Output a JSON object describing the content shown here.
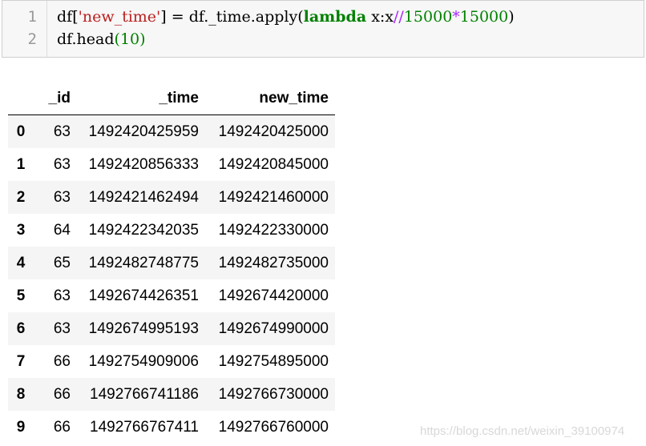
{
  "code_cell": {
    "line_numbers": [
      "1",
      "2"
    ],
    "line1": {
      "p1": "df[",
      "str": "'new_time'",
      "p2": "] = df._time.apply(",
      "kw": "lambda",
      "p3": " x:x",
      "op1": "//",
      "n1": "15000",
      "op2": "*",
      "n2": "15000",
      "p4": ")"
    },
    "line2": {
      "p1": "df.head",
      "paren_open": "(",
      "num": "10",
      "paren_close": ")"
    }
  },
  "dataframe": {
    "columns": [
      "",
      "_id",
      "_time",
      "new_time"
    ],
    "rows": [
      {
        "index": "0",
        "_id": "63",
        "_time": "1492420425959",
        "new_time": "1492420425000"
      },
      {
        "index": "1",
        "_id": "63",
        "_time": "1492420856333",
        "new_time": "1492420845000"
      },
      {
        "index": "2",
        "_id": "63",
        "_time": "1492421462494",
        "new_time": "1492421460000"
      },
      {
        "index": "3",
        "_id": "64",
        "_time": "1492422342035",
        "new_time": "1492422330000"
      },
      {
        "index": "4",
        "_id": "65",
        "_time": "1492482748775",
        "new_time": "1492482735000"
      },
      {
        "index": "5",
        "_id": "63",
        "_time": "1492674426351",
        "new_time": "1492674420000"
      },
      {
        "index": "6",
        "_id": "63",
        "_time": "1492674995193",
        "new_time": "1492674990000"
      },
      {
        "index": "7",
        "_id": "66",
        "_time": "1492754909006",
        "new_time": "1492754895000"
      },
      {
        "index": "8",
        "_id": "66",
        "_time": "1492766741186",
        "new_time": "1492766730000"
      },
      {
        "index": "9",
        "_id": "66",
        "_time": "1492766767411",
        "new_time": "1492766760000"
      }
    ]
  },
  "watermark": "https://blog.csdn.net/weixin_39100974"
}
